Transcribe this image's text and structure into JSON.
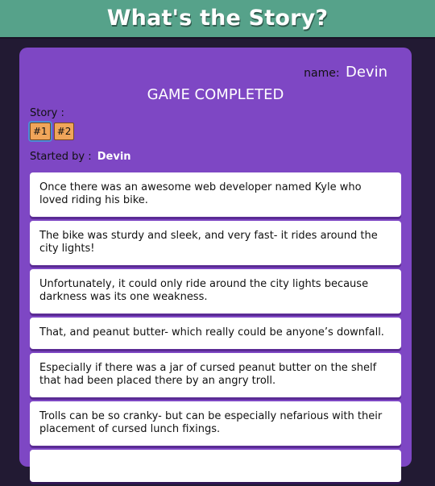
{
  "header": {
    "title": "What's the Story?"
  },
  "user": {
    "name_label": "name:",
    "name_value": "Devin"
  },
  "game": {
    "status": "GAME COMPLETED",
    "story_label": "Story :",
    "stories": [
      {
        "label": "#1",
        "active": true
      },
      {
        "label": "#2",
        "active": false
      }
    ],
    "started_label": "Started by :",
    "started_by": "Devin"
  },
  "entries": [
    {
      "text": "Once there was an awesome web developer named Kyle who loved riding his bike."
    },
    {
      "text": "The bike was sturdy and sleek, and very fast- it rides around the city lights!"
    },
    {
      "text": "Unfortunately, it could only ride around the city lights because darkness was its one weakness."
    },
    {
      "text": "That, and peanut butter- which really could be anyone’s downfall."
    },
    {
      "text": "Especially if there was a jar of cursed peanut butter on the shelf that had been placed there by an angry troll."
    },
    {
      "text": "Trolls can be so cranky- but can be especially nefarious with their placement of cursed lunch fixings."
    },
    {
      "text": ""
    }
  ],
  "colors": {
    "header": "#56a28a",
    "background": "#221a33",
    "card": "#7e47c4",
    "story_button": "#f0a55a"
  }
}
